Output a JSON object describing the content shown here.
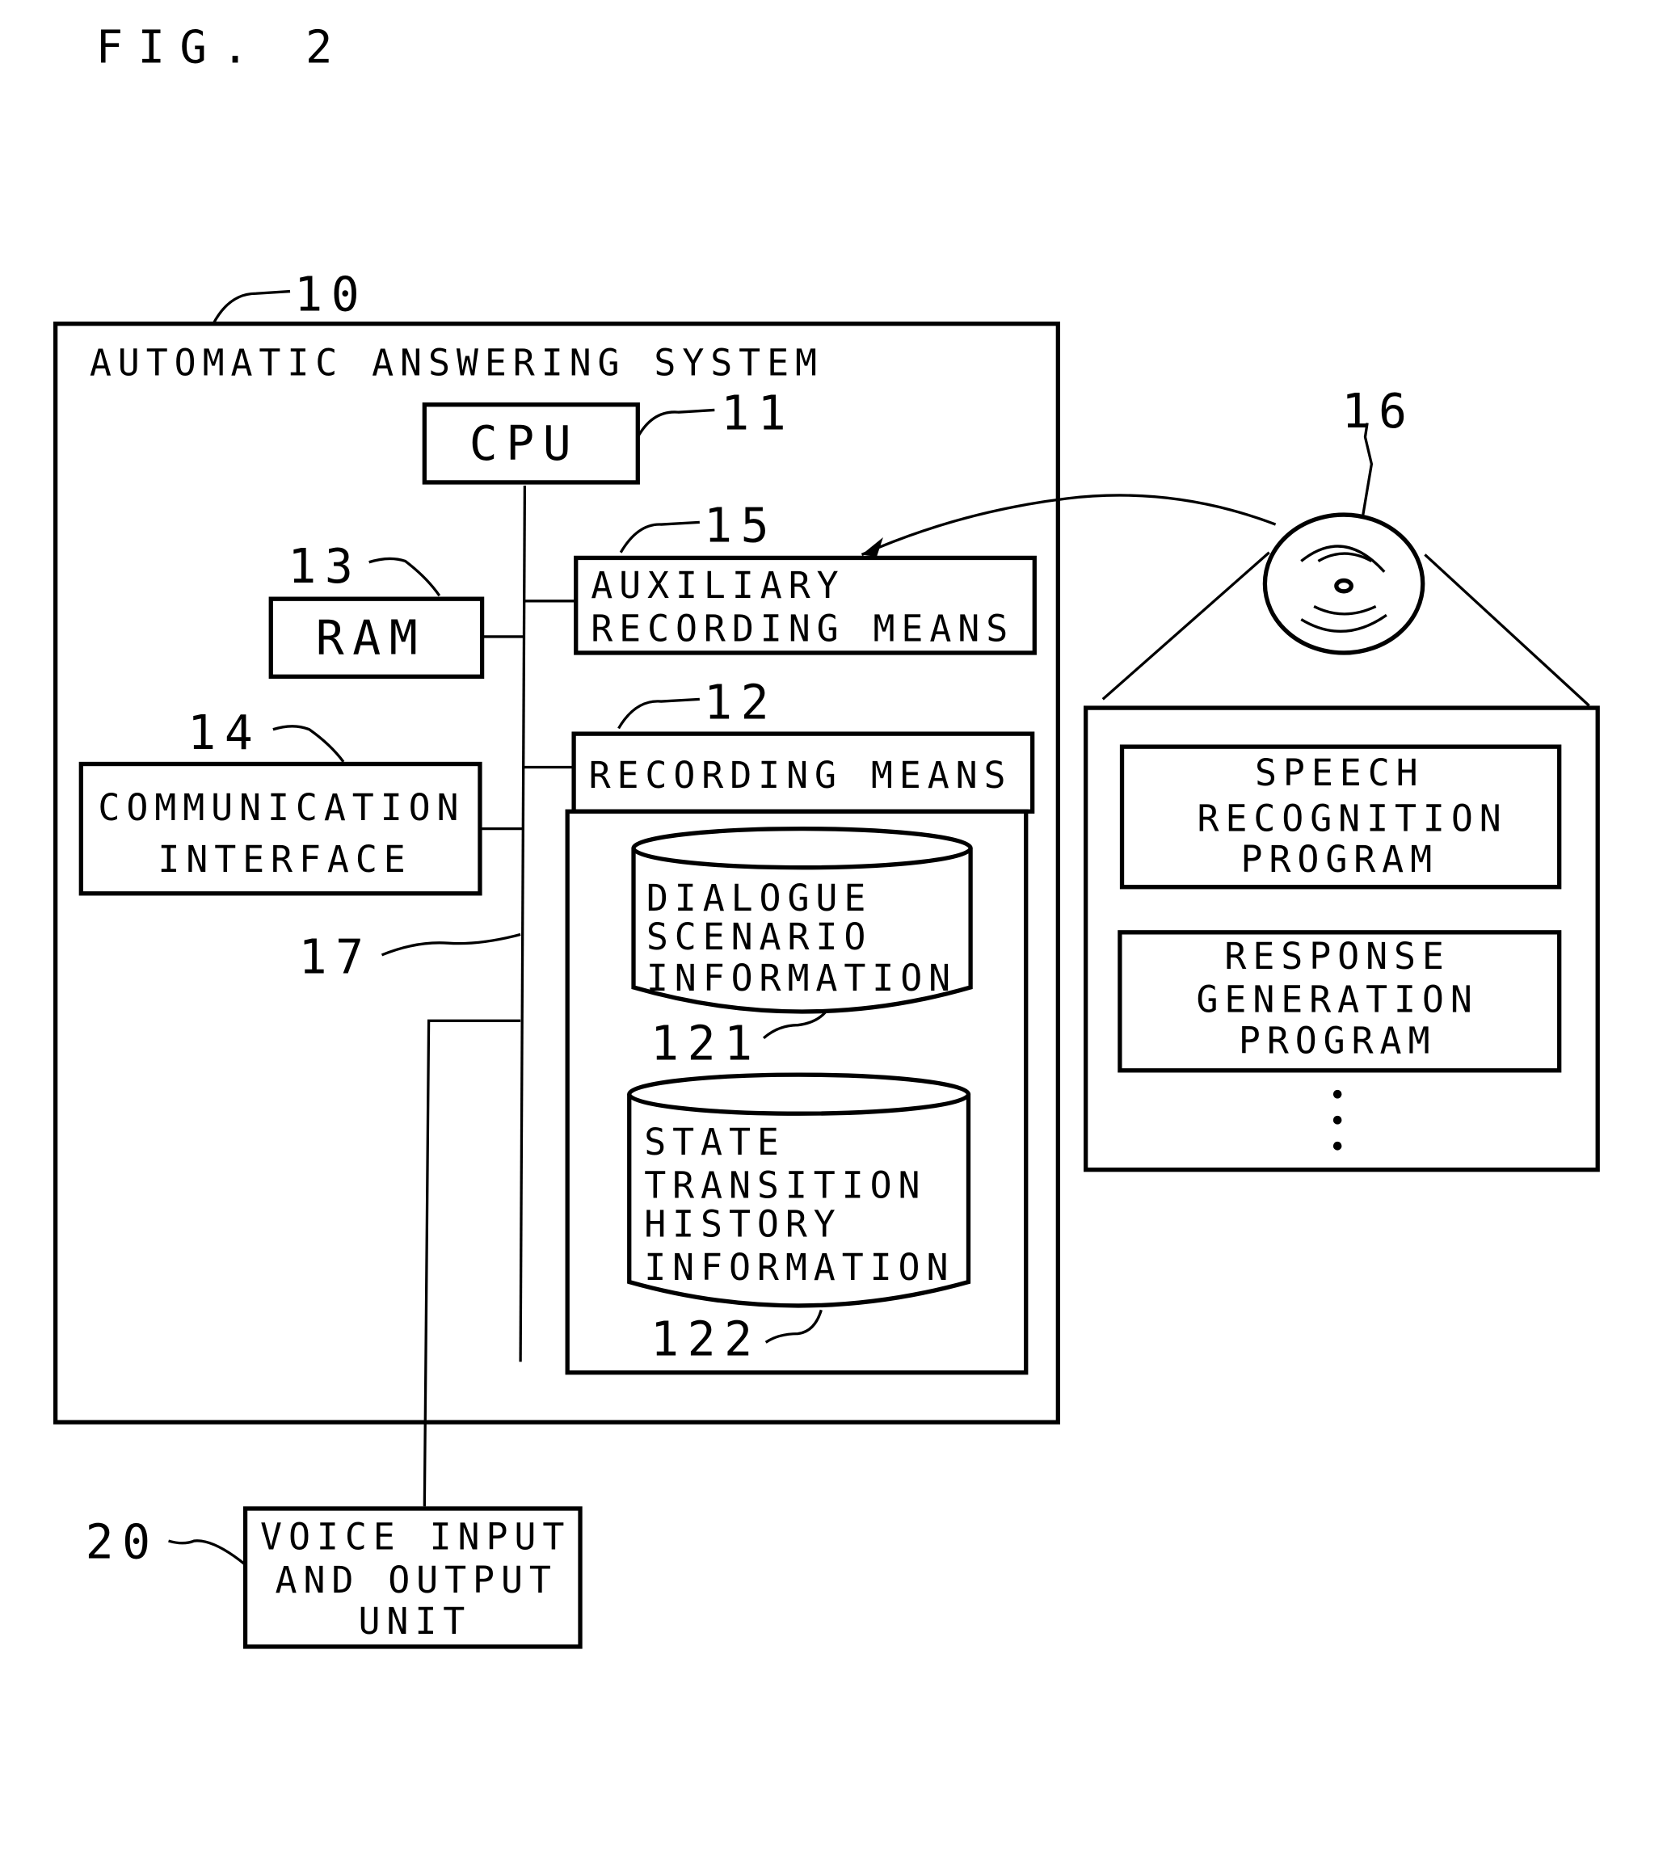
{
  "figure": {
    "title": "FIG. 2"
  },
  "system": {
    "ref": "10",
    "title": "AUTOMATIC ANSWERING SYSTEM",
    "cpu": {
      "ref": "11",
      "label": "CPU"
    },
    "ram": {
      "ref": "13",
      "label": "RAM"
    },
    "comm": {
      "ref": "14",
      "lines": [
        "COMMUNICATION",
        "INTERFACE"
      ]
    },
    "aux": {
      "ref": "15",
      "lines": [
        "AUXILIARY",
        "RECORDING MEANS"
      ]
    },
    "recording": {
      "ref": "12",
      "label": "RECORDING MEANS",
      "db1": {
        "ref": "121",
        "lines": [
          "DIALOGUE",
          "SCENARIO",
          "INFORMATION"
        ]
      },
      "db2": {
        "ref": "122",
        "lines": [
          "STATE",
          "TRANSITION",
          "HISTORY",
          "INFORMATION"
        ]
      }
    },
    "bus": {
      "ref": "17"
    }
  },
  "medium": {
    "ref": "16",
    "programs": [
      {
        "lines": [
          "SPEECH",
          "RECOGNITION",
          "PROGRAM"
        ]
      },
      {
        "lines": [
          "RESPONSE",
          "GENERATION",
          "PROGRAM"
        ]
      }
    ],
    "ellipsis": "⋮"
  },
  "voice_unit": {
    "ref": "20",
    "lines": [
      "VOICE INPUT",
      "AND OUTPUT",
      "UNIT"
    ]
  }
}
